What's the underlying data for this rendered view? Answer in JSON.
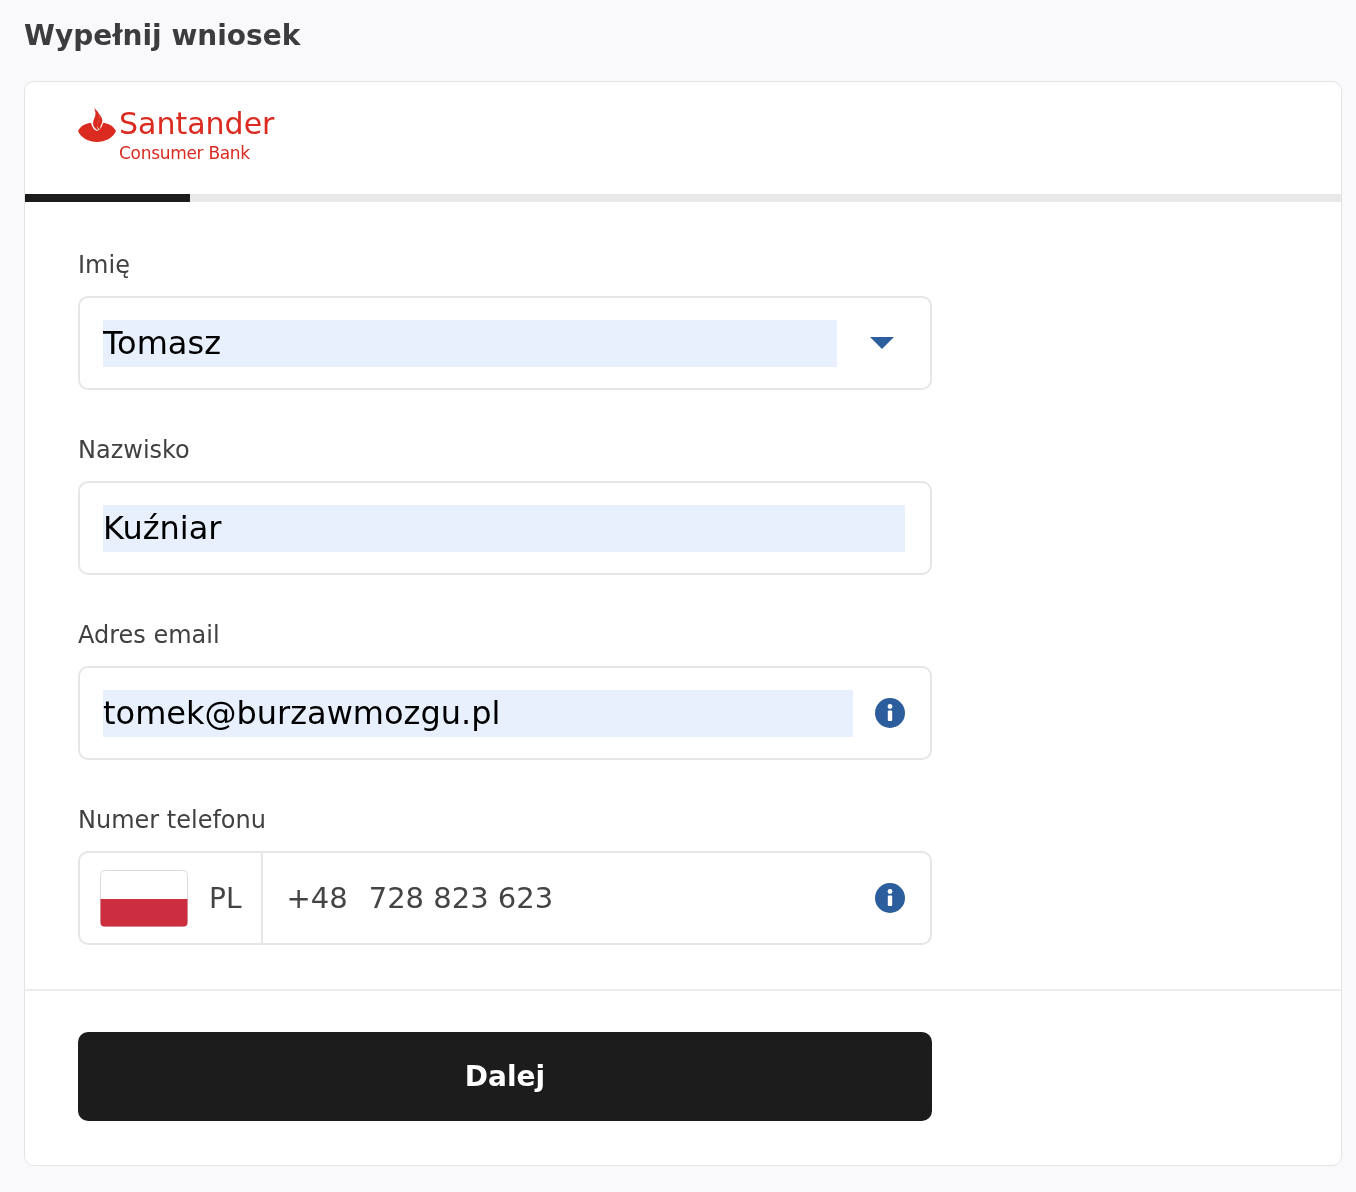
{
  "page": {
    "title": "Wypełnij wniosek"
  },
  "logo": {
    "name": "Santander",
    "subtitle": "Consumer Bank"
  },
  "progress": {
    "level": 0.125
  },
  "fields": [
    {
      "kind": "select",
      "label": "Imię",
      "value": "Tomasz",
      "autofilled": true,
      "info": false
    },
    {
      "kind": "text",
      "label": "Nazwisko",
      "value": "Kuźniar",
      "autofilled": true,
      "info": false
    },
    {
      "kind": "text",
      "label": "Adres email",
      "value": "tomek@burzawmozgu.pl",
      "autofilled": true,
      "info": true
    },
    {
      "kind": "phone",
      "label": "Numer telefonu",
      "country": "PL",
      "dial_code": "+48",
      "value": "728 823 623",
      "autofilled": false,
      "info": true
    }
  ],
  "buttons": [
    {
      "label": "Dalej"
    }
  ]
}
